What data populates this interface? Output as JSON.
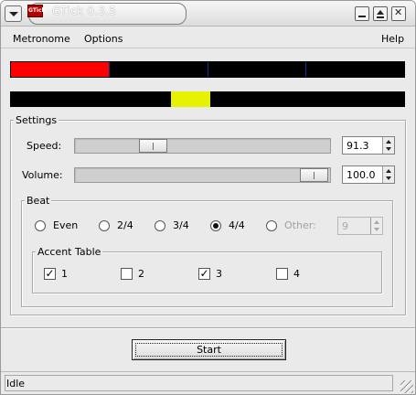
{
  "window": {
    "title": "GTick 0.3.5",
    "app_icon_text": "GTick"
  },
  "menubar": {
    "items": [
      {
        "label": "Metronome"
      },
      {
        "label": "Options"
      },
      {
        "label": "Help"
      }
    ]
  },
  "indicator": {
    "beats_total": 4,
    "active_beat": 1,
    "active_color": "#ff0000",
    "divider_color": "#1a2d8a",
    "pendulum_color": "#e6f200",
    "pendulum_fraction": 0.408
  },
  "settings": {
    "title": "Settings",
    "speed": {
      "label": "Speed:",
      "value": "91.3",
      "slider_fraction": 0.25
    },
    "volume": {
      "label": "Volume:",
      "value": "100.0",
      "slider_fraction": 1.0
    }
  },
  "beat": {
    "title": "Beat",
    "options": [
      {
        "label": "Even",
        "selected": false
      },
      {
        "label": "2/4",
        "selected": false
      },
      {
        "label": "3/4",
        "selected": false
      },
      {
        "label": "4/4",
        "selected": true
      },
      {
        "label": "Other:",
        "selected": false
      }
    ],
    "other_value": "9"
  },
  "accent_table": {
    "title": "Accent Table",
    "items": [
      {
        "label": "1",
        "checked": true
      },
      {
        "label": "2",
        "checked": false
      },
      {
        "label": "3",
        "checked": true
      },
      {
        "label": "4",
        "checked": false
      }
    ]
  },
  "start_button": {
    "label": "Start"
  },
  "status": {
    "text": "Idle"
  }
}
